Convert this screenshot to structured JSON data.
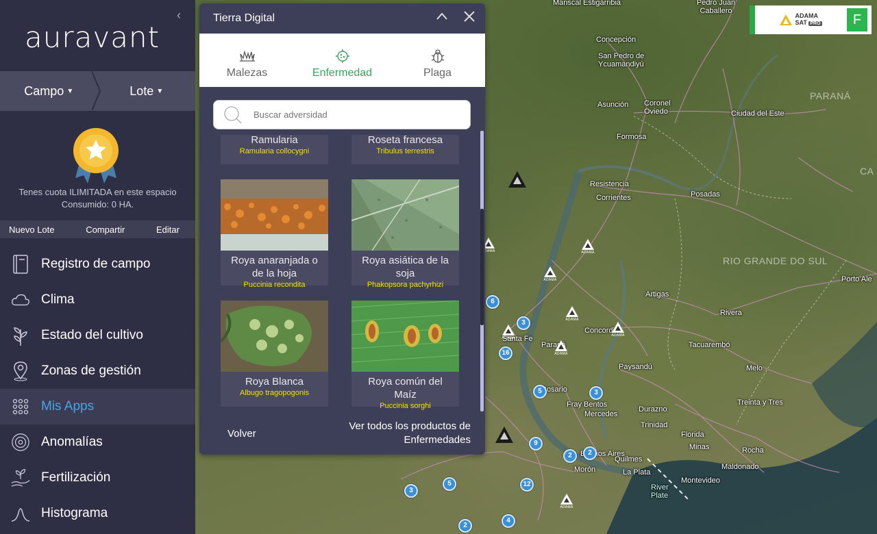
{
  "sidebar": {
    "logo": "auravant",
    "collapse_icon": "chevron-left-icon",
    "campo": "Campo",
    "lote": "Lote",
    "quota_line1": "Tenes cuota ILIMITADA en este espacio",
    "quota_line2": "Consumido: 0 HA.",
    "actions": [
      "Nuevo Lote",
      "Compartir",
      "Editar"
    ],
    "menu": [
      {
        "label": "Registro de campo",
        "icon": "book-icon"
      },
      {
        "label": "Clima",
        "icon": "cloud-icon"
      },
      {
        "label": "Estado del cultivo",
        "icon": "plant-icon"
      },
      {
        "label": "Zonas de gestión",
        "icon": "map-pin-icon"
      },
      {
        "label": "Mis Apps",
        "icon": "apps-grid-icon",
        "active": true
      },
      {
        "label": "Anomalías",
        "icon": "target-icon"
      },
      {
        "label": "Fertilización",
        "icon": "hand-plant-icon"
      },
      {
        "label": "Histograma",
        "icon": "bell-curve-icon"
      }
    ]
  },
  "panel": {
    "title": "Tierra Digital",
    "tabs": [
      {
        "label": "Malezas",
        "icon": "weed-icon"
      },
      {
        "label": "Enfermedad",
        "icon": "virus-icon",
        "active": true
      },
      {
        "label": "Plaga",
        "icon": "bug-icon"
      }
    ],
    "search_placeholder": "Buscar adversidad",
    "cards": [
      {
        "name": "Ramularia",
        "sci": "Ramularia collocygni"
      },
      {
        "name": "Roseta francesa",
        "sci": "Tribulus terrestris"
      },
      {
        "name": "Roya anaranjada o de la hoja",
        "sci": "Puccinia recondita"
      },
      {
        "name": "Roya asiática de la soja",
        "sci": "Phakopsora pachyrhizi"
      },
      {
        "name": "Roya Blanca",
        "sci": "Albugo tragopogonis"
      },
      {
        "name": "Roya común del Maíz",
        "sci": "Puccinia sorghi"
      }
    ],
    "back": "Volver",
    "view_all": "Ver todos los productos de Enfermedades"
  },
  "map": {
    "badge_brand": "ADAMA",
    "badge_sub": "SAT",
    "badge_pro": "PRO",
    "badge_letter": "F",
    "labels": [
      "Mariscal Estigarribia",
      "Pedro Juan Caballero",
      "Concepción",
      "San Pedro de Ycuamandiyú",
      "PARANÁ",
      "Asunción",
      "Coronel Oviedo",
      "Ciudad del Este",
      "Formosa",
      "Resistencia",
      "Corrientes",
      "Posadas",
      "RIO GRANDE DO SUL",
      "Porto Ale",
      "Artigas",
      "Rivera",
      "Concordia",
      "Santa Fe",
      "Paraná",
      "Tacuarembó",
      "Paysandú",
      "Melo",
      "Rosario",
      "Fray Bentos",
      "Mercedes",
      "Treinta y Tres",
      "Durazno",
      "Trinidad",
      "Florida",
      "Minas",
      "Rocha",
      "Buenos Aires",
      "Quilmes",
      "Morón",
      "La Plata",
      "Montevideo",
      "Maldonado",
      "River Plate",
      "CA"
    ],
    "clusters": [
      "6",
      "3",
      "16",
      "5",
      "3",
      "9",
      "2",
      "2",
      "5",
      "3",
      "12",
      "4",
      "2"
    ]
  },
  "colors": {
    "sidebar_bg": "#2e2f45",
    "accent_blue": "#4ba3e3",
    "accent_green": "#3aa35a",
    "sci_yellow": "#f2e200"
  }
}
